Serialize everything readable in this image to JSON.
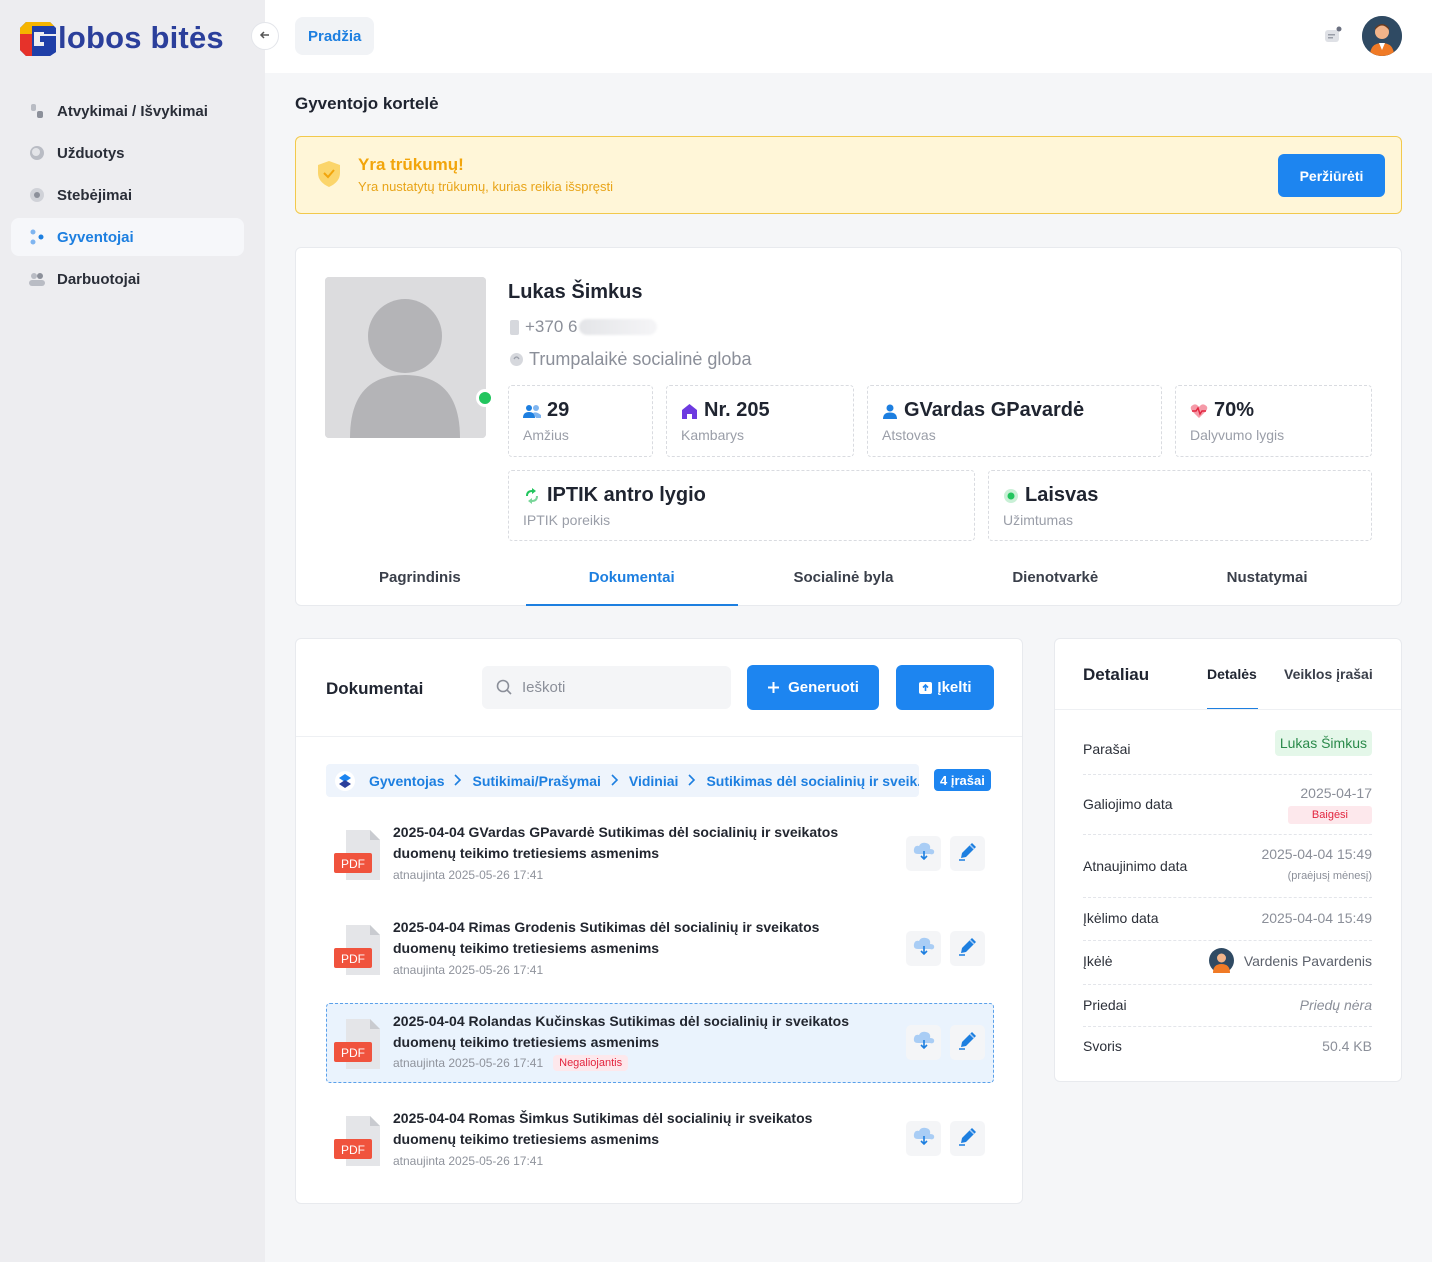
{
  "app": {
    "brand_letter": "G",
    "brand_rest": "lobos bitės"
  },
  "colors": {
    "accent": "#1d85f0",
    "warning": "#f2a50c",
    "danger": "#e2253f",
    "success": "#22c55e"
  },
  "sidebar": {
    "collapse_icon": "arrow-left-icon",
    "items": [
      {
        "label": "Atvykimai / Išvykimai",
        "icon": "arrivals-icon",
        "active": false
      },
      {
        "label": "Užduotys",
        "icon": "tasks-icon",
        "active": false
      },
      {
        "label": "Stebėjimai",
        "icon": "eye-icon",
        "active": false
      },
      {
        "label": "Gyventojai",
        "icon": "residents-icon",
        "active": true
      },
      {
        "label": "Darbuotojai",
        "icon": "employees-icon",
        "active": false
      }
    ]
  },
  "topbar": {
    "home": "Pradžia",
    "messages_icon": "chat-icon",
    "avatar_icon": "user-avatar-icon"
  },
  "page": {
    "title": "Gyventojo kortelė"
  },
  "alert": {
    "title": "Yra trūkumų!",
    "description": "Yra nustatytų trūkumų, kurias reikia išspręsti",
    "button": "Peržiūrėti"
  },
  "profile": {
    "name": "Lukas Šimkus",
    "phone": "+370 6",
    "care_type": "Trumpalaikė socialinė globa",
    "stats": [
      {
        "value": "29",
        "label": "Amžius",
        "icon": "people-icon"
      },
      {
        "value": "Nr. 205",
        "label": "Kambarys",
        "icon": "home-icon"
      },
      {
        "value": "GVardas GPavardė",
        "label": "Atstovas",
        "icon": "person-icon"
      },
      {
        "value": "70%",
        "label": "Dalyvumo lygis",
        "icon": "heartbeat-icon"
      },
      {
        "value": "IPTIK antro lygio",
        "label": "IPTIK poreikis",
        "icon": "recycle-icon"
      },
      {
        "value": "Laisvas",
        "label": "Užimtumas",
        "icon": "status-dot-icon"
      }
    ],
    "tabs": [
      "Pagrindinis",
      "Dokumentai",
      "Socialinė byla",
      "Dienotvarkė",
      "Nustatymai"
    ],
    "active_tab": "Dokumentai"
  },
  "documents": {
    "title": "Dokumentai",
    "search_placeholder": "Ieškoti",
    "generate_button": "Generuoti",
    "upload_button": "Įkelti",
    "breadcrumb": [
      "Gyventojas",
      "Sutikimai/Prašymai",
      "Vidiniai",
      "Sutikimas dėl socialinių ir sveik..."
    ],
    "count": "4 įrašai",
    "file_badge": "PDF",
    "items": [
      {
        "title": "2025-04-04 GVardas GPavardė Sutikimas dėl socialinių ir sveikatos duomenų teikimo tretiesiems asmenims",
        "meta": "atnaujinta 2025-05-26 17:41",
        "badge": "",
        "selected": false
      },
      {
        "title": "2025-04-04 Rimas Grodenis Sutikimas dėl socialinių ir sveikatos duomenų teikimo tretiesiems asmenims",
        "meta": "atnaujinta 2025-05-26 17:41",
        "badge": "",
        "selected": false
      },
      {
        "title": "2025-04-04 Rolandas Kučinskas Sutikimas dėl socialinių ir sveikatos duomenų teikimo tretiesiems asmenims",
        "meta": "atnaujinta 2025-05-26 17:41",
        "badge": "Negaliojantis",
        "selected": true
      },
      {
        "title": "2025-04-04 Romas Šimkus Sutikimas dėl socialinių ir sveikatos duomenų teikimo tretiesiems asmenims",
        "meta": "atnaujinta 2025-05-26 17:41",
        "badge": "",
        "selected": false
      }
    ]
  },
  "details": {
    "title": "Detaliau",
    "tabs": [
      "Detalės",
      "Veiklos įrašai"
    ],
    "active_tab": "Detalės",
    "rows": {
      "signatures": {
        "label": "Parašai",
        "value": "Lukas Šimkus"
      },
      "validity": {
        "label": "Galiojimo data",
        "value": "2025-04-17",
        "badge": "Baigėsi"
      },
      "renewal": {
        "label": "Atnaujinimo data",
        "value": "2025-04-04 15:49",
        "note": "(praėjusį mėnesį)"
      },
      "uploaded": {
        "label": "Įkėlimo data",
        "value": "2025-04-04 15:49"
      },
      "uploader": {
        "label": "Įkėlė",
        "value": "Vardenis Pavardenis"
      },
      "attachments": {
        "label": "Priedai",
        "value": "Priedų nėra"
      },
      "size": {
        "label": "Svoris",
        "value": "50.4 KB"
      }
    }
  }
}
